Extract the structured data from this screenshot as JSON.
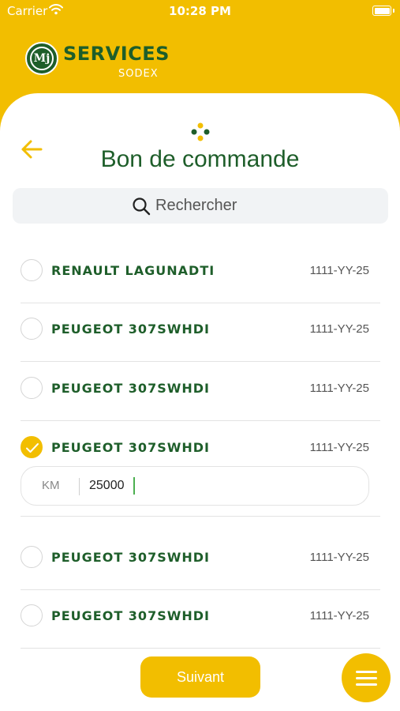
{
  "status_bar": {
    "carrier": "Carrier",
    "time": "10:28 PM"
  },
  "brand": {
    "logo_text": "Mj",
    "name": "SERVICES",
    "sub": "SODEX"
  },
  "colors": {
    "accent": "#F2BE00",
    "brand_green": "#1E5E2A"
  },
  "page": {
    "title": "Bon de commande"
  },
  "search": {
    "placeholder": "Rechercher"
  },
  "vehicles": [
    {
      "name": "RENAULT LAGUNADTI",
      "plate": "1111-YY-25",
      "selected": false
    },
    {
      "name": "PEUGEOT 307SWHDI",
      "plate": "1111-YY-25",
      "selected": false
    },
    {
      "name": "PEUGEOT 307SWHDI",
      "plate": "1111-YY-25",
      "selected": false
    },
    {
      "name": "PEUGEOT 307SWHDI",
      "plate": "1111-YY-25",
      "selected": true
    },
    {
      "name": "PEUGEOT 307SWHDI",
      "plate": "1111-YY-25",
      "selected": false
    },
    {
      "name": "PEUGEOT 307SWHDI",
      "plate": "1111-YY-25",
      "selected": false
    }
  ],
  "km_field": {
    "label": "KM",
    "value": "25000"
  },
  "footer": {
    "next_label": "Suivant"
  },
  "icons": [
    "wifi-icon",
    "battery-icon",
    "back-arrow-icon",
    "dots-icon",
    "search-icon",
    "check-icon",
    "hamburger-menu-icon"
  ]
}
